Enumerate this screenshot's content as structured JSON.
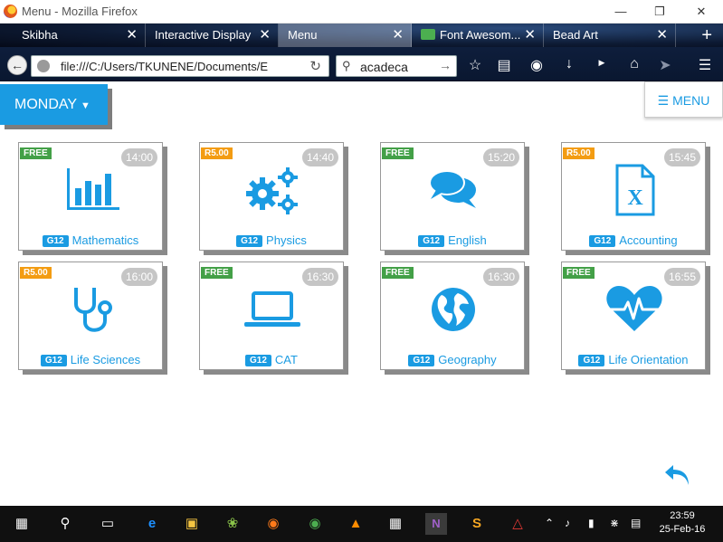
{
  "window": {
    "title": "Menu - Mozilla Firefox"
  },
  "tabs": [
    {
      "label": "Skibha"
    },
    {
      "label": "Interactive Display"
    },
    {
      "label": "Menu"
    },
    {
      "label": "Font Awesom..."
    },
    {
      "label": "Bead Art"
    }
  ],
  "nav": {
    "url": "file:///C:/Users/TKUNENE/Documents/E",
    "search_query": "acadeca"
  },
  "page": {
    "day_label": "MONDAY",
    "menu_label": "MENU"
  },
  "cards": [
    {
      "badge": "FREE",
      "time": "14:00",
      "grade": "G12",
      "subject": "Mathematics",
      "icon": "bar-chart-icon"
    },
    {
      "badge": "R5.00",
      "time": "14:40",
      "grade": "G12",
      "subject": "Physics",
      "icon": "gears-icon"
    },
    {
      "badge": "FREE",
      "time": "15:20",
      "grade": "G12",
      "subject": "English",
      "icon": "speech-bubbles-icon"
    },
    {
      "badge": "R5.00",
      "time": "15:45",
      "grade": "G12",
      "subject": "Accounting",
      "icon": "excel-file-icon"
    },
    {
      "badge": "R5.00",
      "time": "16:00",
      "grade": "G12",
      "subject": "Life Sciences",
      "icon": "stethoscope-icon"
    },
    {
      "badge": "FREE",
      "time": "16:30",
      "grade": "G12",
      "subject": "CAT",
      "icon": "laptop-icon"
    },
    {
      "badge": "FREE",
      "time": "16:30",
      "grade": "G12",
      "subject": "Geography",
      "icon": "globe-icon"
    },
    {
      "badge": "FREE",
      "time": "16:55",
      "grade": "G12",
      "subject": "Life Orientation",
      "icon": "heartbeat-icon"
    }
  ],
  "taskbar": {
    "time": "23:59",
    "date": "25-Feb-16"
  },
  "colors": {
    "accent": "#1a9be2",
    "free_badge": "#43a047",
    "paid_badge": "#f39c12",
    "time_pill": "#c5c5c5"
  }
}
